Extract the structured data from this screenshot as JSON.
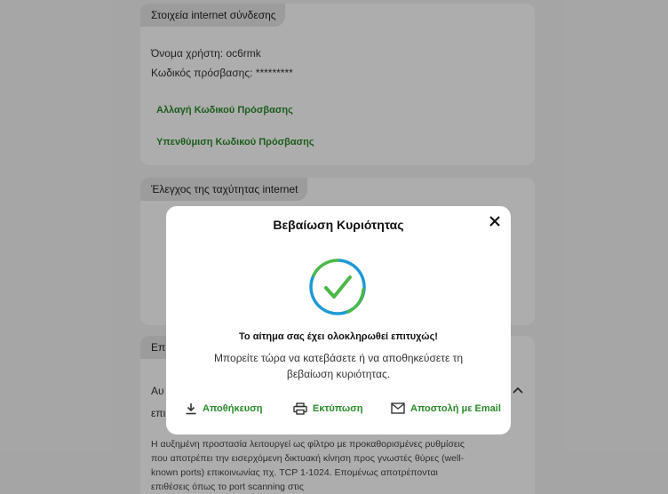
{
  "background": {
    "internet_card": {
      "tab": "Στοιχεία internet σύνδεσης",
      "username": "Όνομα χρήστη: oc6rmk",
      "password": "Κωδικός πρόσβασης: *********",
      "change_password_link": "Αλλαγή Κωδικού Πρόσβασης",
      "remind_password_link": "Υπενθύμιση Κωδικού Πρόσβασης"
    },
    "speed_card": {
      "tab": "Έλεγχος της ταχύτητας internet"
    },
    "protection_card": {
      "tab_fragment": "Επι",
      "heading_fragment": "Αυ",
      "line_fragment": "επι",
      "description": "Η αυξημένη προστασία λειτουργεί ως φίλτρο με προκαθορισμένες ρυθμίσεις που αποτρέπει την εισερχόμενη δικτυακή κίνηση προς γνωστές θύρες (well-known ports) επικοινωνίας πχ. TCP 1-1024. Επομένως αποτρέπονται επιθέσεις όπως το port scanning στις"
    }
  },
  "modal": {
    "title": "Βεβαίωση Κυριότητας",
    "success_message": "Το αίτημα σας έχει ολοκληρωθεί επιτυχώς!",
    "sub_message": "Μπορείτε τώρα να κατεβάσετε ή να αποθηκεύσετε τη βεβαίωση κυριότητας.",
    "actions": {
      "save": "Αποθήκευση",
      "print": "Εκτύπωση",
      "email": "Αποστολή με Email"
    },
    "icons": {
      "close": "close-icon",
      "success": "check-circle-icon",
      "save": "download-icon",
      "print": "printer-icon",
      "email": "mail-icon"
    },
    "colors": {
      "accent_green": "#2a8a2a",
      "check_blue": "#1e9ad6",
      "check_green": "#4cb848"
    }
  }
}
